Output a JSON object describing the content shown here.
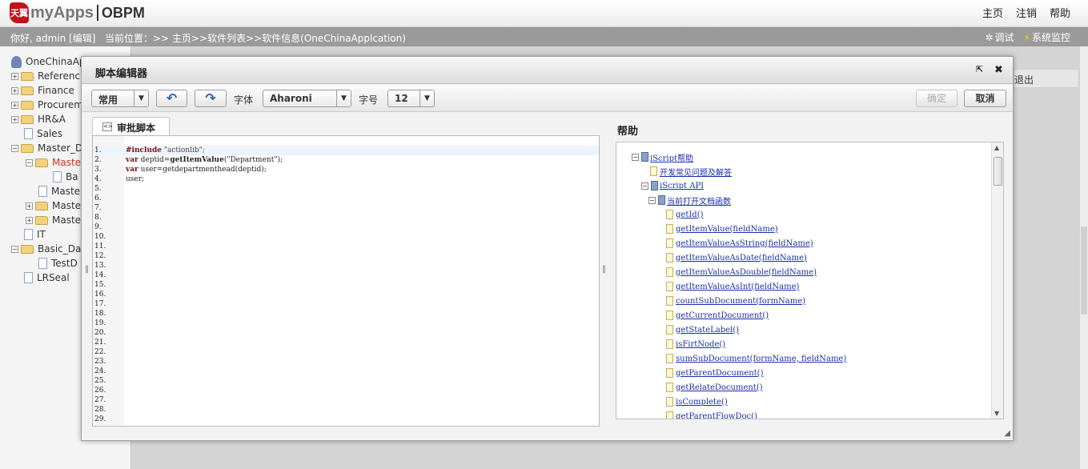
{
  "app": {
    "logo_mark": "天翼",
    "logo_myapps": "myApps",
    "logo_obpm": "OBPM",
    "top_links": [
      "主页",
      "注销",
      "帮助"
    ]
  },
  "infobar": {
    "greeting": "你好, admin [编辑]",
    "location": "当前位置：>> 主页>>软件列表>>软件信息(OneChinaApplcation)",
    "debug": "调试",
    "monitor": "系统监控"
  },
  "tree": {
    "root": "OneChinaAp",
    "items": [
      "Referenc",
      "Finance",
      "Procurem",
      "HR&A",
      "Sales",
      "Master_D",
      "Maste",
      "Ba",
      "Maste",
      "Maste",
      "Maste",
      "IT",
      "Basic_Da",
      "TestD",
      "LRSeal"
    ]
  },
  "bg": {
    "exit": "退出"
  },
  "dialog": {
    "title": "脚本编辑器",
    "popout_icon": "popout-icon",
    "close_icon": "close-icon"
  },
  "toolbar": {
    "common_select": "常用",
    "undo_icon": "undo-icon",
    "redo_icon": "redo-icon",
    "font_label": "字体",
    "font_select": "Aharoni",
    "size_label": "字号",
    "size_select": "12",
    "ok": "确定",
    "cancel": "取消"
  },
  "editor": {
    "tab": "审批脚本",
    "line_numbers": [
      "1.",
      "2.",
      "3.",
      "4.",
      "5.",
      "6.",
      "7.",
      "8.",
      "9.",
      "10.",
      "11.",
      "12.",
      "13.",
      "14.",
      "15.",
      "16.",
      "17.",
      "18.",
      "19.",
      "20.",
      "21.",
      "22.",
      "23.",
      "24.",
      "25.",
      "26.",
      "27.",
      "28.",
      "29."
    ],
    "code": {
      "l1_kw": "#include",
      "l1_str": " \"actionlib\";",
      "l2_kw": "var",
      "l2_a": " deptid=",
      "l2_fn": "getItemValue",
      "l2_b": "(\"Department\");",
      "l3_kw": "var",
      "l3_a": " user=getdepartmenthead(deptid);",
      "l4": "user;"
    }
  },
  "help": {
    "title": "帮助",
    "iscript_help": "iScript帮助",
    "faq": "开发常见问题及解答",
    "api": "iScript API",
    "current_doc": "当前打开文档函数",
    "functions": [
      "getId()",
      "getItemValue(fieldName)",
      "getItemValueAsString(fieldName)",
      "getItemValueAsDate(fieldName)",
      "getItemValueAsDouble(fieldName)",
      "getItemValueAsInt(fieldName)",
      "countSubDocument(formName)",
      "getCurrentDocument()",
      "getStateLabel()",
      "isFirtNode()",
      "sumSubDocument(formName, fieldName)",
      "getParentDocument()",
      "getRelateDocument()",
      "isComplete()",
      "getParentFlowDoc()"
    ]
  }
}
